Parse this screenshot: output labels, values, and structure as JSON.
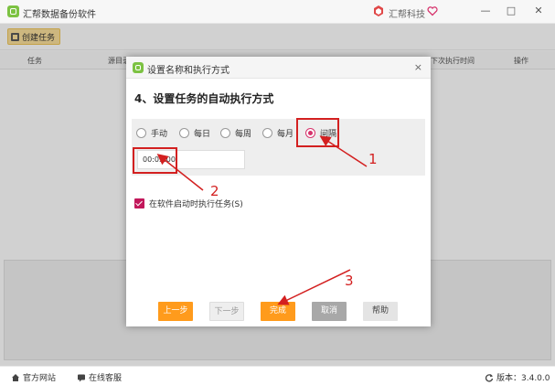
{
  "app": {
    "title": "汇帮数据备份软件",
    "brand": "汇帮科技",
    "accent_color": "#7cc242",
    "window_buttons": [
      "—",
      "□",
      "✕"
    ]
  },
  "toolbar": {
    "create_label": "创建任务"
  },
  "table": {
    "headers": [
      "任务",
      "源目录",
      "下次执行时间",
      "操作"
    ]
  },
  "statusbar": {
    "website_label": "官方网站",
    "support_label": "在线客服",
    "version_label": "版本：3.4.0.0"
  },
  "dialog": {
    "title": "设置名称和执行方式",
    "close": "×",
    "section_title": "4、设置任务的自动执行方式",
    "schedule_options": [
      {
        "label": "手动",
        "checked": false
      },
      {
        "label": "每日",
        "checked": false
      },
      {
        "label": "每周",
        "checked": false
      },
      {
        "label": "每月",
        "checked": false
      },
      {
        "label": "间隔",
        "checked": true
      }
    ],
    "interval_value": "00:05:00",
    "startup_checkbox": {
      "label": "在软件启动时执行任务(S)",
      "checked": true
    },
    "buttons": {
      "prev": "上一步",
      "next": "下一步",
      "done": "完成",
      "cancel": "取消",
      "help": "帮助"
    },
    "checked_color": "#d6336c"
  },
  "annotations": {
    "labels": [
      "1",
      "2",
      "3"
    ],
    "color": "#d32020"
  }
}
